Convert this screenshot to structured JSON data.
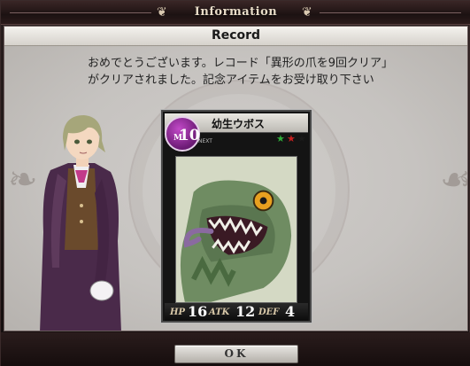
{
  "window": {
    "title": "Information",
    "header": "Record"
  },
  "message": {
    "line1": "おめでとうございます。レコード「異形の爪を9回クリア」",
    "line2": "がクリアされました。記念アイテムをお受け取り下さい"
  },
  "card": {
    "name": "幼生ウボス",
    "cost_prefix": "M",
    "cost": "10",
    "next_label": "NEXT",
    "stars": [
      {
        "color": "#2fae3a"
      },
      {
        "color": "#c81f1f"
      },
      {
        "color": "#1a1a1a"
      }
    ],
    "stats": {
      "hp_label": "HP",
      "hp": "16",
      "atk_label": "ATK",
      "atk": "12",
      "def_label": "DEF",
      "def": "4"
    },
    "badge_color": "#8e2a96"
  },
  "buttons": {
    "ok_label": "OK"
  },
  "icons": {
    "title_left": "fleur-ornament-icon",
    "title_right": "fleur-ornament-icon",
    "star": "star-icon"
  }
}
